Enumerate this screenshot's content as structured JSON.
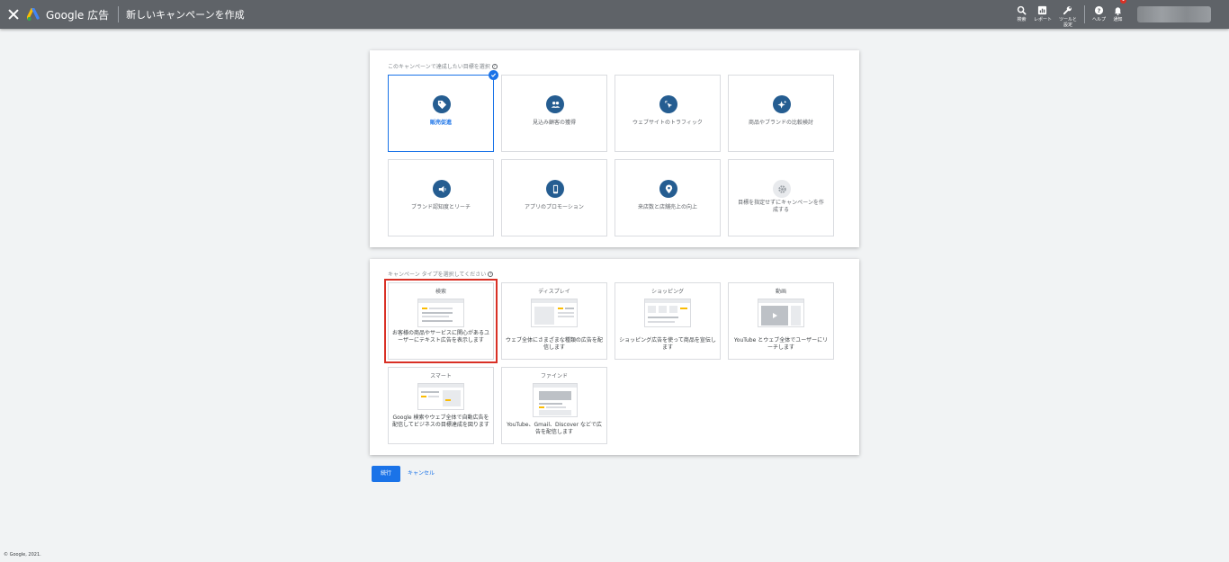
{
  "topbar": {
    "brand": "Google 広告",
    "page_title": "新しいキャンペーンを作成",
    "tools": [
      {
        "label": "検索",
        "icon": "search-icon"
      },
      {
        "label": "レポート",
        "icon": "report-icon"
      },
      {
        "label": "ツールと\n設定",
        "icon": "wrench-icon"
      },
      {
        "label": "ヘルプ",
        "icon": "help-icon"
      },
      {
        "label": "通知",
        "icon": "bell-icon",
        "badge": "1"
      }
    ]
  },
  "goals": {
    "label": "このキャンペーンで達成したい目標を選択",
    "items": [
      {
        "label": "販売促進",
        "icon": "tag-icon",
        "selected": true
      },
      {
        "label": "見込み顧客の獲得",
        "icon": "people-icon"
      },
      {
        "label": "ウェブサイトのトラフィック",
        "icon": "cursor-click-icon"
      },
      {
        "label": "商品やブランドの比較検討",
        "icon": "sparkle-icon"
      },
      {
        "label": "ブランド認知度とリーチ",
        "icon": "megaphone-icon"
      },
      {
        "label": "アプリのプロモーション",
        "icon": "phone-icon"
      },
      {
        "label": "来店数と店舗売上の向上",
        "icon": "location-pin-icon"
      },
      {
        "label": "目標を指定せずにキャンペーンを作成する",
        "icon": "gear-icon"
      }
    ]
  },
  "campaign_types": {
    "label": "キャンペーン タイプを選択してください",
    "items": [
      {
        "title": "検索",
        "desc": "お客様の商品やサービスに関心があるユーザーにテキスト広告を表示します",
        "highlighted": true
      },
      {
        "title": "ディスプレイ",
        "desc": "ウェブ全体にさまざまな種類の広告を配信します"
      },
      {
        "title": "ショッピング",
        "desc": "ショッピング広告を使って商品を宣伝します"
      },
      {
        "title": "動画",
        "desc": "YouTube とウェブ全体でユーザーにリーチします"
      },
      {
        "title": "スマート",
        "desc": "Google 検索やウェブ全体で自動広告を配信してビジネスの目標達成を図ります"
      },
      {
        "title": "ファインド",
        "desc": "YouTube、Gmail、Discover などで広告を配信します"
      }
    ]
  },
  "actions": {
    "continue_label": "続行",
    "cancel_label": "キャンセル"
  },
  "footer": {
    "copyright": "© Google, 2021."
  },
  "colors": {
    "topbar": "#5f6368",
    "accent": "#1a73e8",
    "icon_fill": "#255d91",
    "highlight": "#d93025"
  }
}
